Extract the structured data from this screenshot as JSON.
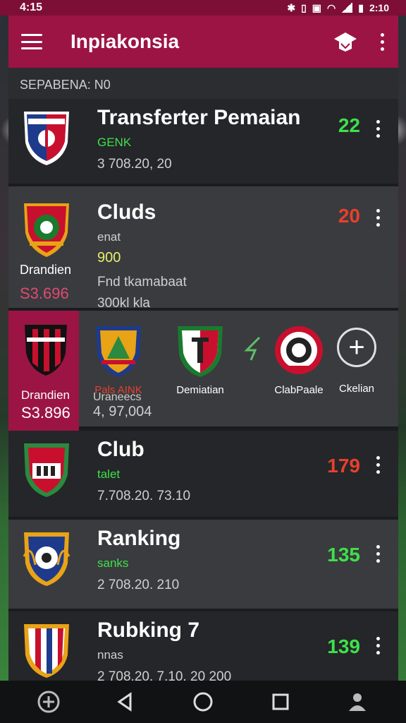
{
  "status_bar": {
    "time": "4:15",
    "clock": "2:10"
  },
  "app_bar": {
    "title": "Inpiakonsia"
  },
  "section": {
    "label": "SEPABENA: N0"
  },
  "rows": [
    {
      "title": "Transferter Pemaian",
      "sub": "GENK",
      "meta": "3 708.20, 20",
      "count": "22",
      "count_color": "#3fe04a",
      "sub_color": "#3fe04a"
    },
    {
      "title": "Cluds",
      "sub": "enat",
      "sub2": "900",
      "meta": "Fnd tkamabaat",
      "meta2": "300kl kla",
      "count": "20",
      "count_color": "#e8402c",
      "left_label": "Drandien",
      "left_amount": "S3.696"
    },
    {
      "title": "Club",
      "sub": "talet",
      "meta": "7.708.20. 73.10",
      "count": "179",
      "count_color": "#e8402c",
      "sub_color": "#3fe04a"
    },
    {
      "title": "Ranking",
      "sub": "sanks",
      "meta": "2 708.20. 210",
      "count": "135",
      "count_color": "#3fe04a",
      "sub_color": "#3fe04a"
    },
    {
      "title": "Rubking 7",
      "sub": "nnas",
      "meta": "2 708.20. 7.10. 20 200",
      "count": "139",
      "count_color": "#3fe04a"
    }
  ],
  "carousel": {
    "left_label": "Drandien",
    "left_amount": "S3.896",
    "items": [
      {
        "caption": "Pals AINK",
        "sub": "Uraneecs",
        "amount": "4, 97,004"
      },
      {
        "caption": "Demiatian"
      },
      {
        "caption": "ClabPaale"
      },
      {
        "caption": "Ckelian"
      }
    ]
  },
  "colors": {
    "brand": "#9c1443",
    "positive": "#3fe04a",
    "negative": "#e8402c"
  },
  "icons": [
    "menu-icon",
    "graduation-cap-icon",
    "more-vert-icon",
    "back-icon",
    "home-icon",
    "recents-icon",
    "profile-icon",
    "app-logo-icon"
  ]
}
